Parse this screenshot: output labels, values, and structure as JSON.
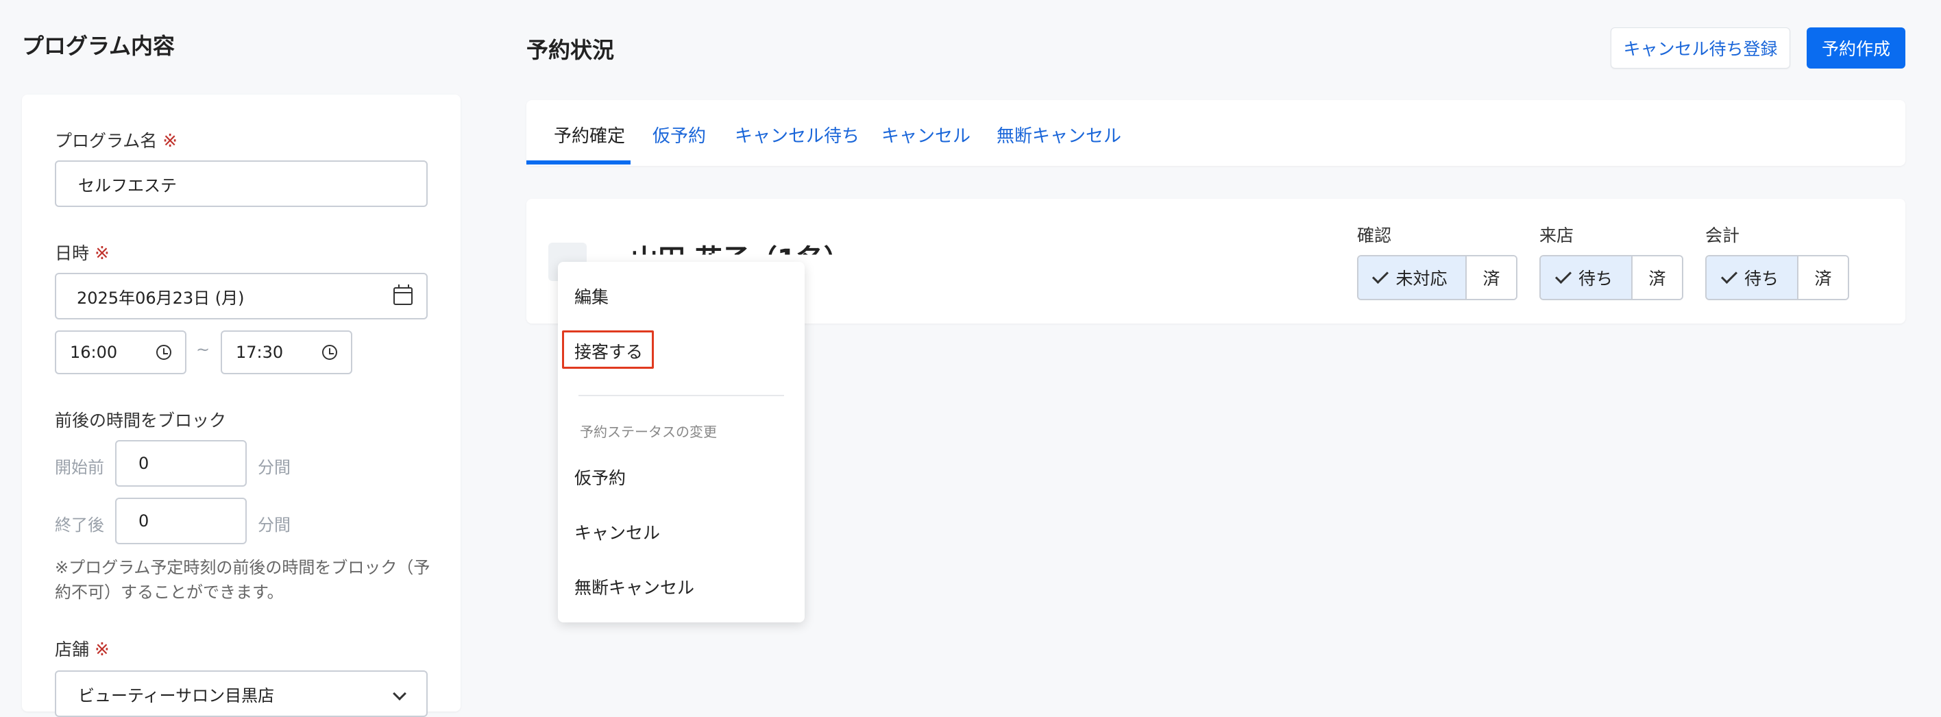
{
  "left": {
    "title": "プログラム内容",
    "program_name": {
      "label": "プログラム名",
      "required_mark": "※",
      "value": "セルフエステ"
    },
    "datetime": {
      "label": "日時",
      "required_mark": "※",
      "date_value": "2025年06月23日 (月)",
      "start_time": "16:00",
      "separator": "~",
      "end_time": "17:30"
    },
    "block_time": {
      "label": "前後の時間をブロック",
      "before_label": "開始前",
      "before_value": "0",
      "before_unit": "分間",
      "after_label": "終了後",
      "after_value": "0",
      "after_unit": "分間",
      "note_line1": "※プログラム予定時刻の前後の時間をブロック（予",
      "note_line2": "約不可）することができます。"
    },
    "store": {
      "label": "店舗",
      "required_mark": "※",
      "value": "ビューティーサロン目黒店"
    }
  },
  "main": {
    "title": "予約状況",
    "waitlist_button": "キャンセル待ち登録",
    "create_button": "予約作成",
    "tabs": [
      {
        "label": "予約確定",
        "active": true
      },
      {
        "label": "仮予約",
        "active": false
      },
      {
        "label": "キャンセル待ち",
        "active": false
      },
      {
        "label": "キャンセル",
        "active": false
      },
      {
        "label": "無断キャンセル",
        "active": false
      }
    ],
    "reservation": {
      "name": "山田 花子（1名）",
      "status_groups": [
        {
          "label": "確認",
          "on_label": "未対応",
          "off_label": "済"
        },
        {
          "label": "来店",
          "on_label": "待ち",
          "off_label": "済"
        },
        {
          "label": "会計",
          "on_label": "待ち",
          "off_label": "済"
        }
      ]
    }
  },
  "menu": {
    "edit": "編集",
    "serve": "接客する",
    "section_title": "予約ステータスの変更",
    "tentative": "仮予約",
    "cancel": "キャンセル",
    "no_show": "無断キャンセル"
  },
  "colors": {
    "accent": "#0a6cf0",
    "link": "#1a66d9",
    "required": "#c0312b",
    "highlight": "#e03a1f"
  }
}
